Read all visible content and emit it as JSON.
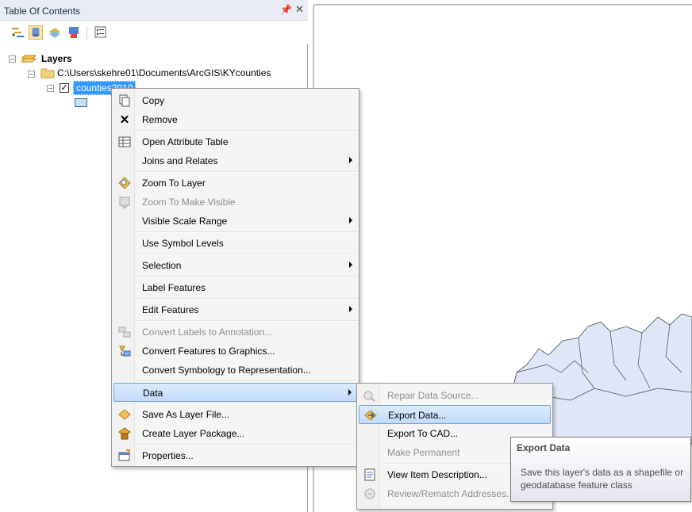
{
  "toc": {
    "title": "Table Of Contents",
    "pin_glyph": "⊕",
    "close_glyph": "✕",
    "toolbar": [
      "list-by-drawing-order-icon",
      "list-by-source-icon",
      "list-by-visibility-icon",
      "list-by-selection-icon",
      "options-icon"
    ]
  },
  "tree": {
    "root_label": "Layers",
    "folder_path": "C:\\Users\\skehre01\\Documents\\ArcGIS\\KYcounties",
    "layer_name": "counties2010"
  },
  "context_menu": {
    "items": [
      {
        "label": "Copy"
      },
      {
        "label": "Remove"
      },
      {
        "label": "Open Attribute Table"
      },
      {
        "label": "Joins and Relates"
      },
      {
        "label": "Zoom To Layer"
      },
      {
        "label": "Zoom To Make Visible"
      },
      {
        "label": "Visible Scale Range"
      },
      {
        "label": "Use Symbol Levels"
      },
      {
        "label": "Selection"
      },
      {
        "label": "Label Features"
      },
      {
        "label": "Edit Features"
      },
      {
        "label": "Convert Labels to Annotation..."
      },
      {
        "label": "Convert Features to Graphics..."
      },
      {
        "label": "Convert Symbology to Representation..."
      },
      {
        "label": "Data"
      },
      {
        "label": "Save As Layer File..."
      },
      {
        "label": "Create Layer Package..."
      },
      {
        "label": "Properties..."
      }
    ]
  },
  "data_submenu": {
    "items": [
      {
        "label": "Repair Data Source..."
      },
      {
        "label": "Export Data..."
      },
      {
        "label": "Export To CAD..."
      },
      {
        "label": "Make Permanent"
      },
      {
        "label": "View Item Description..."
      },
      {
        "label": "Review/Rematch Addresses..."
      }
    ]
  },
  "tooltip": {
    "title": "Export Data",
    "body": "Save this layer's data as a shapefile or geodatabase feature class"
  },
  "colors": {
    "highlight": "#c1dbfc",
    "selection_blue": "#3399ff",
    "map_fill": "#dfe6f7"
  }
}
